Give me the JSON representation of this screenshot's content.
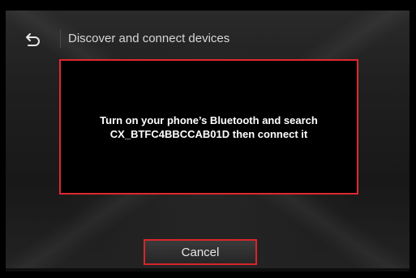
{
  "header": {
    "title": "Discover and connect devices",
    "back_icon": "back-arrow-icon"
  },
  "dialog": {
    "message_line1": "Turn on your phone’s Bluetooth and search",
    "message_line2": "CX_BTFC4BBCCAB01D then connect it"
  },
  "footer": {
    "cancel_label": "Cancel"
  },
  "colors": {
    "accent": "#e0282d",
    "background": "#1f1f1f",
    "dialog_bg": "#000000",
    "text": "#ffffff"
  }
}
